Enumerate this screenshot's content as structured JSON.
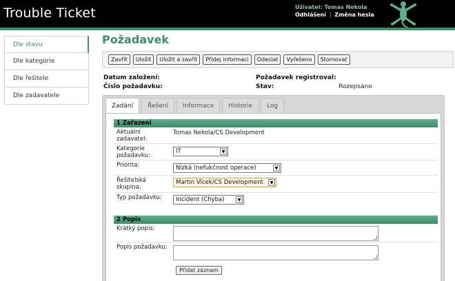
{
  "header": {
    "title": "Trouble Ticket",
    "user_line": "Uživatel: Tomas Nekola",
    "logout": "Odhlášení",
    "separator": "|",
    "change_password": "Změna hesla",
    "logo_icon": "gecko-logo-icon",
    "accent_color": "#3b8d6c"
  },
  "sidebar": {
    "items": [
      {
        "label": "Dle stavu",
        "active": true
      },
      {
        "label": "Dle kategorie"
      },
      {
        "label": "Dle řešitele"
      },
      {
        "label": "Dle zadavatele"
      }
    ]
  },
  "main": {
    "title": "Požadavek",
    "toolbar": [
      "Zavřít",
      "Uložit",
      "Uložit a zavřít",
      "Přidej informaci",
      "Odeslat",
      "Vyřešeno",
      "Stornovat"
    ],
    "info": {
      "created_label": "Datum založení:",
      "number_label": "Číslo požadavku:",
      "registered_label": "Požadavek registroval:",
      "state_label": "Stav:",
      "state_value": "Rozepsáno"
    },
    "tabs": [
      "Zadání",
      "Řešení",
      "Informace",
      "Historie",
      "Log"
    ],
    "section1": {
      "title": "1 Zařazení",
      "requester_label": "Aktuální zadavatel:",
      "requester_value": "Tomas Nekola/CS Development",
      "category_label": "Kategorie požadavku:",
      "category_value": "IT",
      "priority_label": "Priorita:",
      "priority_value": "Nízká (nefukčnost operace)",
      "group_label": "Řešitelská skupina:",
      "group_value": "Martin Vlcek/CS Development",
      "type_label": "Typ požadavku:",
      "type_value": "Incident (Chyba)"
    },
    "section2": {
      "title": "2 Popis",
      "short_label": "Krátký popis:",
      "desc_label": "Popis požadavku:",
      "add_record": "Přidat záznam"
    }
  }
}
